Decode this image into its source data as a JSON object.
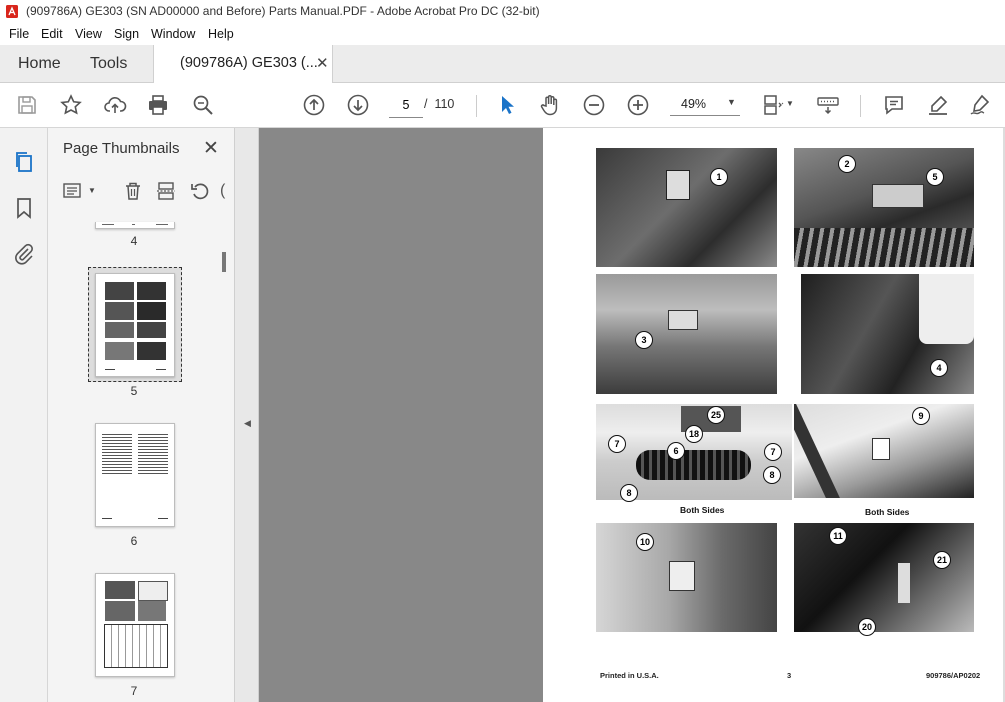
{
  "window": {
    "title": "(909786A) GE303 (SN AD00000 and Before) Parts Manual.PDF - Adobe Acrobat Pro DC (32-bit)"
  },
  "menu": [
    "File",
    "Edit",
    "View",
    "Sign",
    "Window",
    "Help"
  ],
  "tabs": {
    "home": "Home",
    "tools": "Tools",
    "document": "(909786A) GE303 (..."
  },
  "toolbar": {
    "page_current": "5",
    "page_separator": "/",
    "page_total": "110",
    "zoom": "49%"
  },
  "panel": {
    "title": "Page Thumbnails",
    "thumbnails": [
      {
        "label": "4"
      },
      {
        "label": "5"
      },
      {
        "label": "6"
      },
      {
        "label": "7"
      }
    ]
  },
  "document_page": {
    "callouts": [
      "1",
      "2",
      "5",
      "3",
      "4",
      "25",
      "18",
      "9",
      "7",
      "6",
      "7",
      "8",
      "8",
      "10",
      "11",
      "21",
      "20"
    ],
    "captions": [
      "Both Sides",
      "Both Sides"
    ],
    "footer": {
      "left": "Printed in U.S.A.",
      "center": "3",
      "right": "909786/AP0202"
    }
  },
  "colors": {
    "accent": "#1a73c8",
    "acrobat_red": "#d9261c",
    "canvas": "#888888"
  }
}
